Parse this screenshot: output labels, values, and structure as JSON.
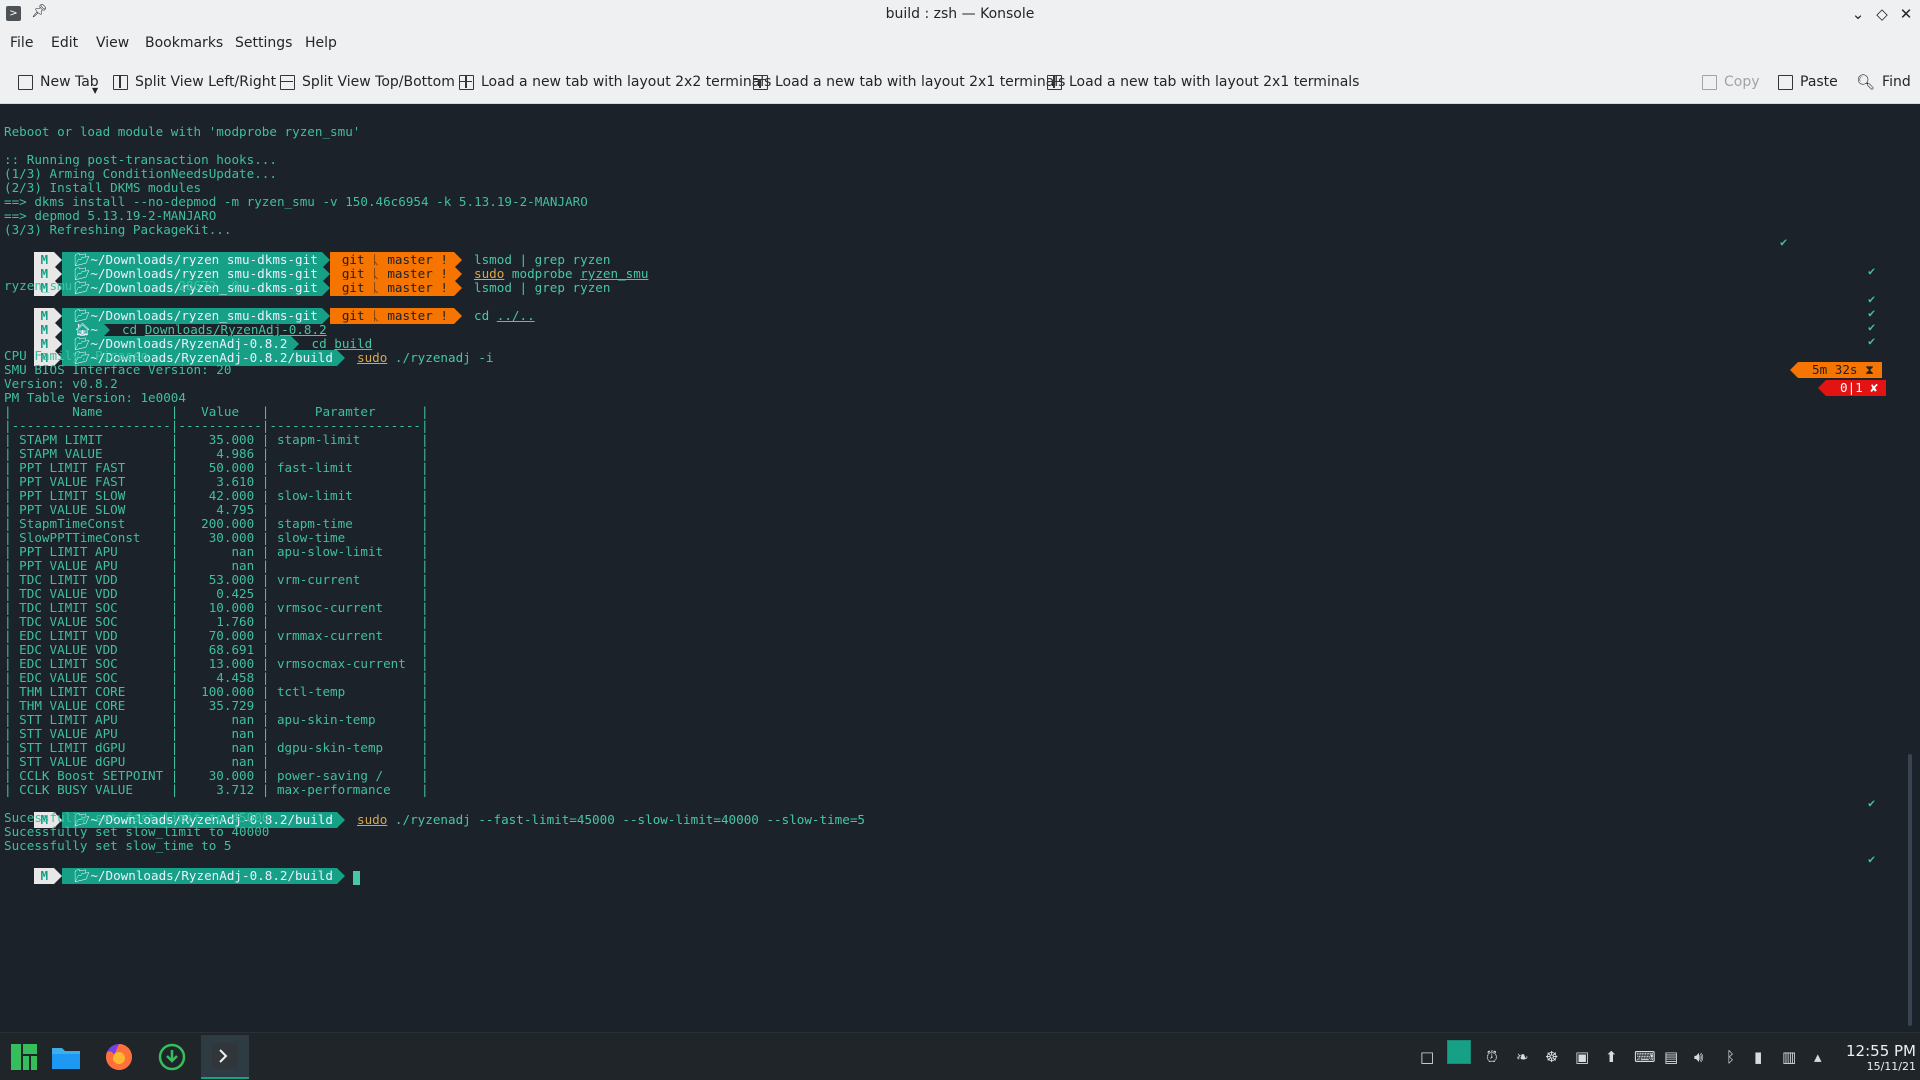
{
  "window": {
    "title": "build : zsh — Konsole"
  },
  "menu": [
    "File",
    "Edit",
    "View",
    "Bookmarks",
    "Settings",
    "Help"
  ],
  "toolbar": {
    "new_tab": "New Tab",
    "split_lr": "Split View Left/Right",
    "split_tb": "Split View Top/Bottom",
    "layout_2x2": "Load a new tab with layout 2x2 terminals",
    "layout_2x1_a": "Load a new tab with layout 2x1 terminals",
    "layout_2x1_b": "Load a new tab with layout 2x1 terminals",
    "copy": "Copy",
    "paste": "Paste",
    "find": "Find"
  },
  "terminal": {
    "out1": "Reboot or load module with 'modprobe ryzen_smu'",
    "out2": ":: Running post-transaction hooks...",
    "out3": "(1/3) Arming ConditionNeedsUpdate...",
    "out4": "(2/3) Install DKMS modules",
    "out5": "==> dkms install --no-depmod -m ryzen_smu -v 150.46c6954 -k 5.13.19-2-MANJARO",
    "out6": "==> depmod 5.13.19-2-MANJARO",
    "out7": "(3/3) Refreshing PackageKit...",
    "path_dkms": "~/Downloads/ryzen_smu-dkms-git",
    "git_label": "git",
    "branch": "master !",
    "branch_glyph": "ᚳ",
    "cmd_lsmod": "lsmod | grep ryzen",
    "cmd_sudo": "sudo",
    "cmd_modprobe": "modprobe",
    "cmd_modprobe_arg": "ryzen_smu",
    "lsmod_out": "ryzen_smu              28672  0",
    "cmd_cd": "cd",
    "cmd_cd_up": "../..",
    "path_home": "~",
    "cmd_cd_dl": "Downloads/RyzenAdj-0.8.2",
    "path_ryzenadj": "~/Downloads/RyzenAdj-0.8.2",
    "cmd_cd_build": "build",
    "path_build": "~/Downloads/RyzenAdj-0.8.2/build",
    "cmd_ryzenadj_i": "./ryzenadj -i",
    "info1": "CPU Family: Picasso",
    "info2": "SMU BIOS Interface Version: 20",
    "info3": "Version: v0.8.2",
    "info4": "PM Table Version: 1e0004",
    "table_header": "|        Name         |   Value   |      Paramter      |",
    "table_sep": "|---------------------|-----------|--------------------|",
    "rows": [
      "| STAPM LIMIT         |    35.000 | stapm-limit        |",
      "| STAPM VALUE         |     4.986 |                    |",
      "| PPT LIMIT FAST      |    50.000 | fast-limit         |",
      "| PPT VALUE FAST      |     3.610 |                    |",
      "| PPT LIMIT SLOW      |    42.000 | slow-limit         |",
      "| PPT VALUE SLOW      |     4.795 |                    |",
      "| StapmTimeConst      |   200.000 | stapm-time         |",
      "| SlowPPTTimeConst    |    30.000 | slow-time          |",
      "| PPT LIMIT APU       |       nan | apu-slow-limit     |",
      "| PPT VALUE APU       |       nan |                    |",
      "| TDC LIMIT VDD       |    53.000 | vrm-current        |",
      "| TDC VALUE VDD       |     0.425 |                    |",
      "| TDC LIMIT SOC       |    10.000 | vrmsoc-current     |",
      "| TDC VALUE SOC       |     1.760 |                    |",
      "| EDC LIMIT VDD       |    70.000 | vrmmax-current     |",
      "| EDC VALUE VDD       |    68.691 |                    |",
      "| EDC LIMIT SOC       |    13.000 | vrmsocmax-current  |",
      "| EDC VALUE SOC       |     4.458 |                    |",
      "| THM LIMIT CORE      |   100.000 | tctl-temp          |",
      "| THM VALUE CORE      |    35.729 |                    |",
      "| STT LIMIT APU       |       nan | apu-skin-temp      |",
      "| STT VALUE APU       |       nan |                    |",
      "| STT LIMIT dGPU      |       nan | dgpu-skin-temp     |",
      "| STT VALUE dGPU      |       nan |                    |",
      "| CCLK Boost SETPOINT |    30.000 | power-saving /     |",
      "| CCLK BUSY VALUE     |     3.712 | max-performance    |"
    ],
    "cmd_ryzenadj_set": "./ryzenadj --fast-limit=45000 --slow-limit=40000 --slow-time=5",
    "res1": "Sucessfully set fast_limit to 45000",
    "res2": "Sucessfully set slow_limit to 40000",
    "res3": "Sucessfully set slow_time to 5",
    "timer": "5m 32s ⧗",
    "err": "0|1 ✘",
    "check": "✔"
  },
  "clock": {
    "time": "12:55 PM",
    "date": "15/11/21"
  },
  "colors": {
    "accent": "#16a085",
    "git_segment": "#f67400",
    "error_segment": "#e31313",
    "terminal_bg": "#1b2229"
  }
}
